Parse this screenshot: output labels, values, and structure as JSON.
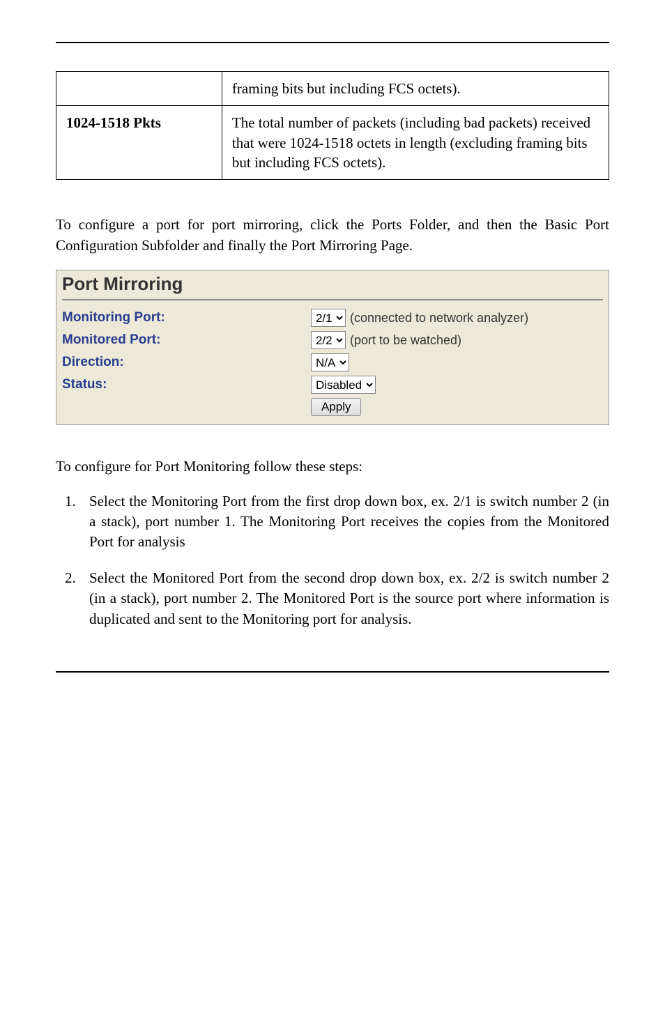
{
  "table": {
    "row1_desc": "framing bits but including FCS octets).",
    "row2_label": "1024-1518 Pkts",
    "row2_desc": "The total number of packets (including bad packets) received that were 1024-1518 octets in length (excluding framing bits but including FCS octets)."
  },
  "intro": "To configure a port for port mirroring, click the Ports Folder, and then the Basic Port Configuration Subfolder and finally the Port Mirroring Page.",
  "panel": {
    "title": "Port Mirroring",
    "monitoring_label": "Monitoring Port:",
    "monitoring_value": "2/1",
    "monitoring_hint": "(connected to network analyzer)",
    "monitored_label": "Monitored Port:",
    "monitored_value": "2/2",
    "monitored_hint": "(port to be watched)",
    "direction_label": "Direction:",
    "direction_value": "N/A",
    "status_label": "Status:",
    "status_value": "Disabled",
    "apply_label": "Apply"
  },
  "steps_intro": "To configure for Port Monitoring follow these steps:",
  "steps": [
    "Select the Monitoring Port from the first drop down box, ex. 2/1 is switch number 2 (in a stack), port number 1.  The Monitoring Port receives the copies from the Monitored Port for analysis",
    "Select the Monitored Port from the second drop down box, ex. 2/2 is switch number 2 (in a stack), port number 2.  The Monitored Port is the source port where information is duplicated and sent to the Monitoring port for analysis."
  ]
}
